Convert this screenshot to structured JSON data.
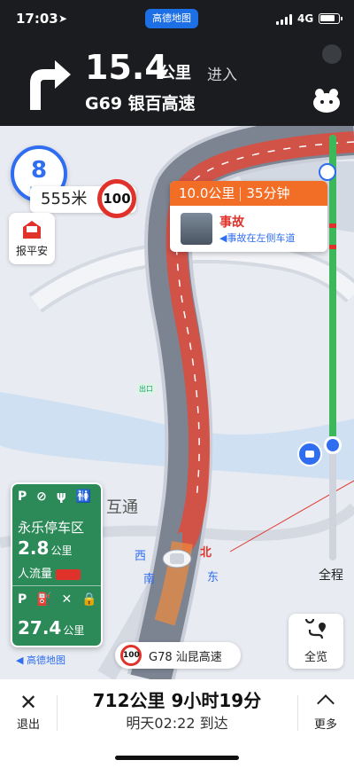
{
  "status": {
    "time": "17:03",
    "app_badge": "高德地图",
    "network": "4G"
  },
  "guidance": {
    "distance": "15.4",
    "unit": "公里",
    "action": "进入",
    "road": "G69 银百高速"
  },
  "speed": {
    "value": "8",
    "unit": "km/h"
  },
  "camera": {
    "distance": "555米",
    "limit": "100"
  },
  "safety": {
    "label": "报平安"
  },
  "incident": {
    "distance": "10.0公里",
    "duration": "35分钟",
    "title": "事故",
    "desc": "◀事故在左侧车道"
  },
  "map": {
    "exit_label": "出口",
    "poi": "互通",
    "dir_west": "西",
    "dir_south": "南",
    "dir_east": "东",
    "dir_north": "北"
  },
  "full_route": {
    "label": "全程"
  },
  "rest_area": {
    "icons": "P  ⊘ ψ 🚻",
    "name": "永乐停车区",
    "distance": "2.8",
    "unit": "公里",
    "flow_label": "人流量",
    "icons2": "P ⛽ ✕ 🔒",
    "distance2": "27.4",
    "unit2": "公里"
  },
  "brand": {
    "label": "◀ 高德地图"
  },
  "road_chip": {
    "limit": "100",
    "name": "G78 汕昆高速"
  },
  "overview": {
    "label": "全览"
  },
  "bottom": {
    "exit_icon": "✕",
    "exit_label": "退出",
    "trip": "712公里 9小时19分",
    "eta": "明天02:22 到达",
    "more_label": "更多"
  },
  "colors": {
    "route_red": "#e0322a",
    "accent_blue": "#2f6ef0",
    "progress_green": "#3cb85a",
    "incident_orange": "#f26d25",
    "rest_green": "#2c8a58"
  }
}
